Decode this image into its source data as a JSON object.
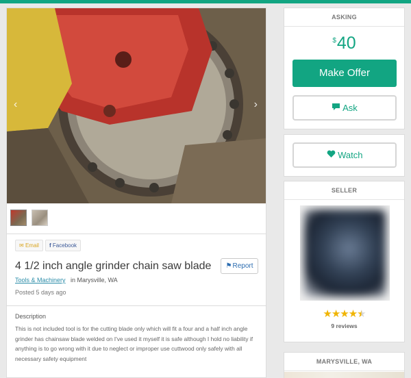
{
  "listing": {
    "title": "4 1/2 inch angle grinder chain saw blade",
    "category": "Tools & Machinery",
    "location": "in Marysville, WA",
    "posted": "Posted 5 days ago",
    "description_heading": "Description",
    "description": "This is not included tool is for the cutting blade only which will fit a four and a half inch angle grinder has chainsaw blade welded on I've used it myself it is safe although I hold no liability if anything is to go wrong with it due to neglect or improper use cuttwood only safely with all necessary safety equipment",
    "report_label": "Report"
  },
  "share": {
    "email_label": "Email",
    "facebook_label": "Facebook"
  },
  "gallery": {
    "prev_glyph": "‹",
    "next_glyph": "›",
    "thumb_count": 2
  },
  "sidebar": {
    "asking_heading": "ASKING",
    "currency": "$",
    "price": "40",
    "make_offer_label": "Make Offer",
    "ask_label": "Ask",
    "watch_label": "Watch",
    "seller_heading": "SELLER",
    "rating": 4.5,
    "reviews": "9 reviews",
    "city_heading": "MARYSVILLE, WA"
  },
  "colors": {
    "accent": "#12a582",
    "link": "#2a8ca8",
    "star": "#f0b400"
  }
}
